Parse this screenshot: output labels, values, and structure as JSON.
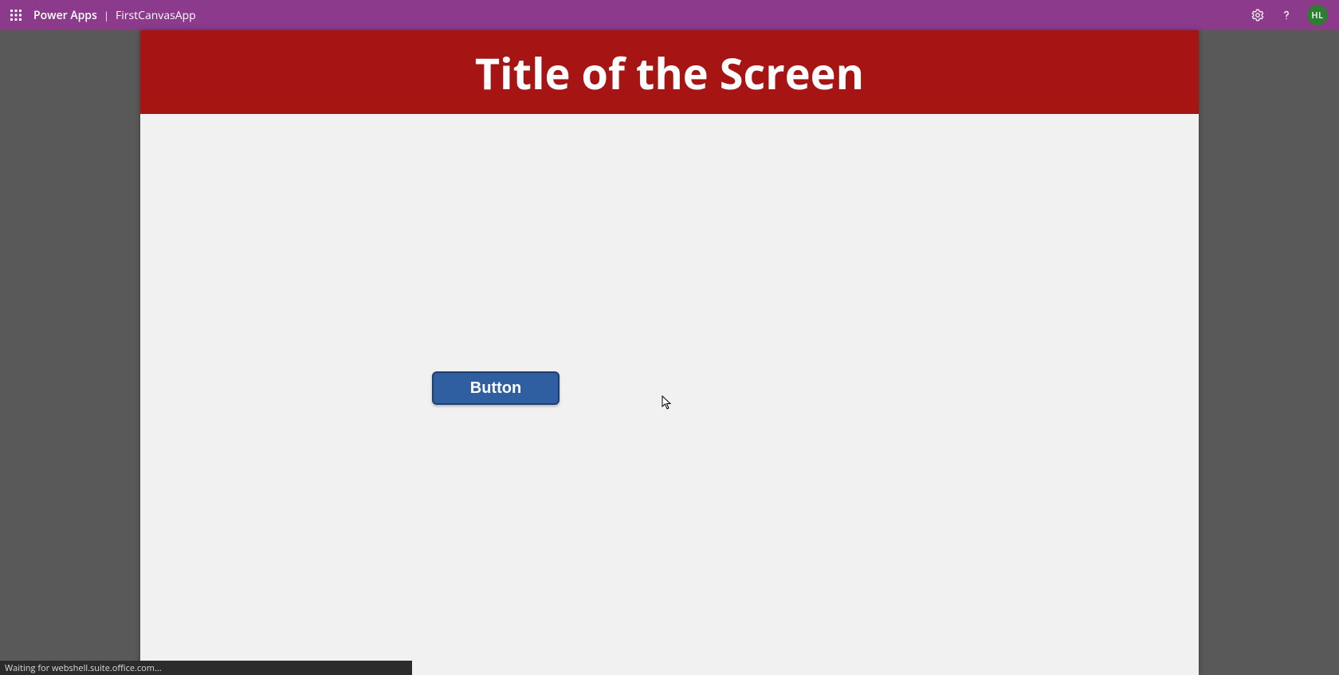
{
  "header": {
    "brand": "Power Apps",
    "separator": "|",
    "app_name": "FirstCanvasApp",
    "avatar_initials": "HL"
  },
  "screen": {
    "title": "Title of the Screen",
    "button_label": "Button"
  },
  "status": {
    "text": "Waiting for webshell.suite.office.com..."
  }
}
